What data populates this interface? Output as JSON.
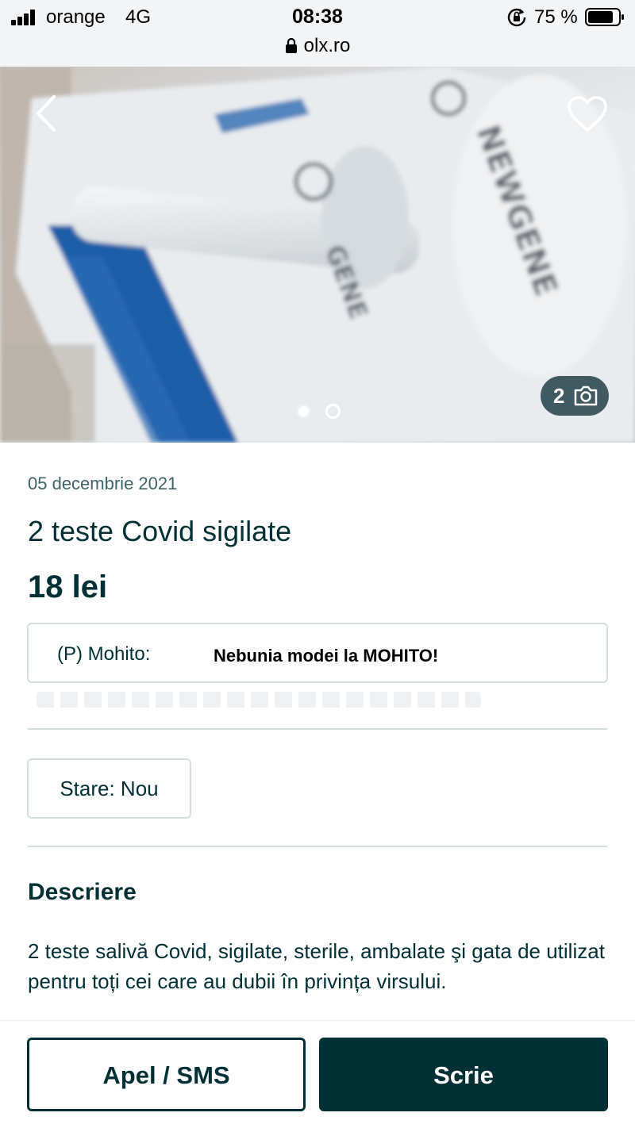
{
  "status_bar": {
    "carrier": "orange",
    "network": "4G",
    "time": "08:38",
    "url": "olx.ro",
    "battery_percent": "75 %"
  },
  "gallery": {
    "photo_count": "2",
    "current_index": 1,
    "total_images": 2,
    "icons": [
      "back-arrow-icon",
      "heart-icon",
      "camera-icon"
    ]
  },
  "listing": {
    "date": "05 decembrie 2021",
    "title": "2 teste Covid sigilate",
    "price": "18 lei"
  },
  "ad": {
    "prefix": "(P) Mohito:",
    "text": "Nebunia modei la MOHITO!"
  },
  "attributes": {
    "state": "Stare: Nou"
  },
  "description": {
    "heading": "Descriere",
    "text": "2 teste salivă Covid, sigilate, sterile, ambalate şi gata de utilizat pentru toți cei care au dubii în privința virsului."
  },
  "actions": {
    "call_label": "Apel / SMS",
    "write_label": "Scrie"
  },
  "colors": {
    "brand_dark": "#002f34",
    "status_bar_bg": "#f2f4f5",
    "border": "#d8dfe0"
  }
}
